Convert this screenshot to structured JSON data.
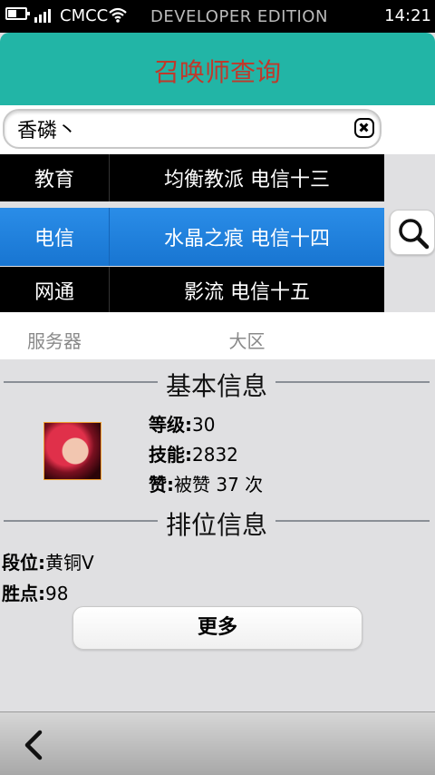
{
  "status_bar": {
    "carrier": "CMCC",
    "edition": "DEVELOPER EDITION",
    "time": "14:21"
  },
  "header": {
    "title": "召唤师查询"
  },
  "search": {
    "value": "香磷丶"
  },
  "picker": {
    "rows": [
      {
        "server": "教育",
        "region": "均衡教派 电信十三"
      },
      {
        "server": "电信",
        "region": "水晶之痕 电信十四"
      },
      {
        "server": "网通",
        "region": "影流 电信十五"
      }
    ],
    "selected_index": 1,
    "captions": {
      "server": "服务器",
      "region": "大区"
    }
  },
  "basic_info": {
    "title": "基本信息",
    "level_label": "等级:",
    "level_value": "30",
    "skill_label": "技能:",
    "skill_value": "2832",
    "like_label": "赞:",
    "like_value": "被赞 37 次"
  },
  "rank_info": {
    "title": "排位信息",
    "tier_label": "段位:",
    "tier_value": "黄铜V",
    "points_label": "胜点:",
    "points_value": "98"
  },
  "more_button": "更多",
  "colors": {
    "header_bg": "#22b5a6",
    "header_title": "#c0392b",
    "picker_selected": "#1875d1"
  }
}
